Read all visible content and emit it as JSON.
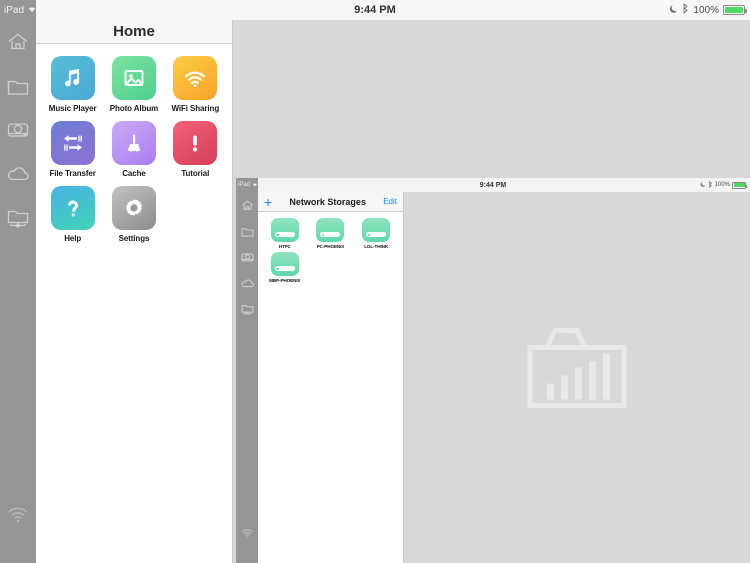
{
  "status_bar": {
    "device_label": "iPad",
    "wifi_icon": "wifi-icon",
    "time": "9:44 PM",
    "moon_icon": "moon-icon",
    "bluetooth_icon": "bluetooth-icon",
    "battery_percent": "100%",
    "battery_level": 100,
    "battery_icon": "battery-full-icon"
  },
  "sidebar": {
    "items": [
      {
        "name": "sidebar-item-home",
        "icon": "home-icon"
      },
      {
        "name": "sidebar-item-local-folder",
        "icon": "folder-icon"
      },
      {
        "name": "sidebar-item-disk",
        "icon": "hard-disk-icon"
      },
      {
        "name": "sidebar-item-cloud",
        "icon": "cloud-icon"
      },
      {
        "name": "sidebar-item-network-folder",
        "icon": "network-folder-icon"
      }
    ],
    "bottom_item": {
      "name": "sidebar-item-wifi",
      "icon": "wifi-icon"
    }
  },
  "home_panel": {
    "title": "Home",
    "apps": [
      {
        "label": "Music Player",
        "icon": "music-note-icon",
        "color_start": "#56bfd4",
        "color_end": "#4aa8d8"
      },
      {
        "label": "Photo Album",
        "icon": "photo-image-icon",
        "color_start": "#7fe3a0",
        "color_end": "#4ccf8f"
      },
      {
        "label": "WiFi Sharing",
        "icon": "wifi-icon",
        "color_start": "#ffc93c",
        "color_end": "#f7a52b"
      },
      {
        "label": "File Transfer",
        "icon": "transfer-arrows-icon",
        "color_start": "#6a7fd4",
        "color_end": "#8d6fd1"
      },
      {
        "label": "Cache",
        "icon": "broom-icon",
        "color_start": "#c9a8f5",
        "color_end": "#a87ef0"
      },
      {
        "label": "Tutorial",
        "icon": "exclamation-icon",
        "color_start": "#f0566b",
        "color_end": "#d8415c"
      },
      {
        "label": "Help",
        "icon": "question-mark-icon",
        "color_start": "#47b6e0",
        "color_end": "#3fd0b8"
      },
      {
        "label": "Settings",
        "icon": "gear-icon",
        "color_start": "#bdbdbd",
        "color_end": "#8e8e8e"
      }
    ]
  },
  "nested_screenshot": {
    "status_bar": {
      "device_label": "iPad",
      "wifi_icon": "wifi-icon",
      "time": "9:44 PM",
      "moon_icon": "moon-icon",
      "bluetooth_icon": "bluetooth-icon",
      "battery_percent": "100%",
      "battery_level": 100
    },
    "sidebar": {
      "items": [
        {
          "name": "sidebar-item-home",
          "icon": "home-icon"
        },
        {
          "name": "sidebar-item-local-folder",
          "icon": "folder-icon"
        },
        {
          "name": "sidebar-item-disk",
          "icon": "hard-disk-icon"
        },
        {
          "name": "sidebar-item-cloud",
          "icon": "cloud-icon"
        },
        {
          "name": "sidebar-item-network-folder",
          "icon": "network-folder-icon"
        }
      ],
      "bottom_item": {
        "name": "sidebar-item-wifi",
        "icon": "wifi-icon"
      }
    },
    "panel": {
      "add_label": "+",
      "title": "Network Storages",
      "edit_label": "Edit",
      "storages": [
        {
          "label": "HTPC",
          "icon": "nas-device-icon"
        },
        {
          "label": "PC-PHOENIX",
          "icon": "nas-device-icon"
        },
        {
          "label": "LGL-THINK",
          "icon": "nas-device-icon"
        },
        {
          "label": "MBP-PHOENIX",
          "icon": "nas-device-icon"
        }
      ]
    },
    "content": {
      "placeholder_icon": "folder-with-bar-chart-icon"
    }
  },
  "colors": {
    "accent_blue": "#1a84f7",
    "battery_green": "#4cd964",
    "sidebar_gray": "#969696",
    "content_gray": "#d8d8d8",
    "nas_green": "#5fd8ab"
  }
}
